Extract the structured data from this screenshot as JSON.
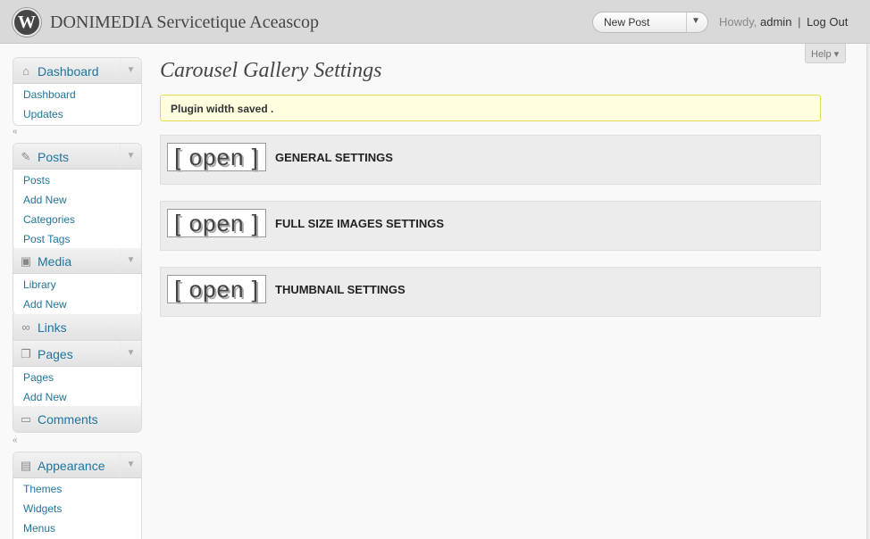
{
  "header": {
    "logo_glyph": "W",
    "site_title": "DONIMEDIA Servicetique Aceascop",
    "new_post": "New Post",
    "howdy": "Howdy,",
    "username": "admin",
    "separator": "|",
    "logout": "Log Out"
  },
  "help": "Help ▾",
  "sidebar": {
    "dashboard": {
      "label": "Dashboard",
      "items": [
        "Dashboard",
        "Updates"
      ]
    },
    "posts": {
      "label": "Posts",
      "items": [
        "Posts",
        "Add New",
        "Categories",
        "Post Tags"
      ]
    },
    "media": {
      "label": "Media",
      "items": [
        "Library",
        "Add New"
      ]
    },
    "links": {
      "label": "Links"
    },
    "pages": {
      "label": "Pages",
      "items": [
        "Pages",
        "Add New"
      ]
    },
    "comments": {
      "label": "Comments"
    },
    "appearance": {
      "label": "Appearance",
      "items": [
        "Themes",
        "Widgets",
        "Menus"
      ]
    },
    "collapse_glyph": "«"
  },
  "main": {
    "title": "Carousel Gallery Settings",
    "notice": "Plugin width saved .",
    "open_label": "[ open ]",
    "panels": [
      "GENERAL SETTINGS",
      "FULL SIZE IMAGES SETTINGS",
      "THUMBNAIL SETTINGS"
    ]
  }
}
